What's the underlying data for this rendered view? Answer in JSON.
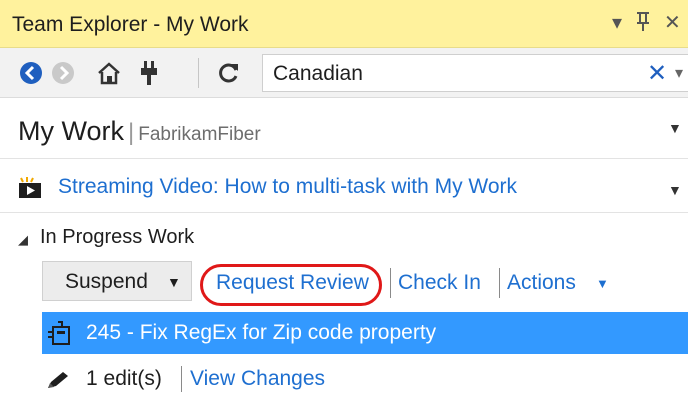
{
  "window": {
    "title": "Team Explorer - My Work",
    "dropdown_glyph": "▾",
    "pin_glyph": "ᅟ꜖",
    "close_glyph": "✕"
  },
  "toolbar": {
    "icons": [
      "back-icon",
      "forward-icon",
      "home-icon",
      "connect-icon",
      "refresh-icon"
    ],
    "search_value": "Canadian",
    "clear_glyph": "✕",
    "dropdown_glyph": "▾"
  },
  "page": {
    "title": "My Work",
    "separator": "|",
    "project": "FabrikamFiber",
    "caret": "▼"
  },
  "video": {
    "link": "Streaming Video: How to multi-task with My Work",
    "caret": "▼"
  },
  "in_progress": {
    "section_title": "In Progress Work",
    "expander": "◢",
    "suspend_label": "Suspend",
    "suspend_caret": "▼",
    "actions": {
      "request_review": "Request Review",
      "check_in": "Check In",
      "actions": "Actions",
      "actions_caret": "▼"
    },
    "work_item": "245 - Fix RegEx for Zip code property",
    "edits": "1 edit(s)",
    "view_changes": "View Changes"
  },
  "colors": {
    "title_bar": "#fff29d",
    "selection": "#3399ff",
    "link": "#1e6fd0",
    "highlight_ring": "#e01818"
  }
}
